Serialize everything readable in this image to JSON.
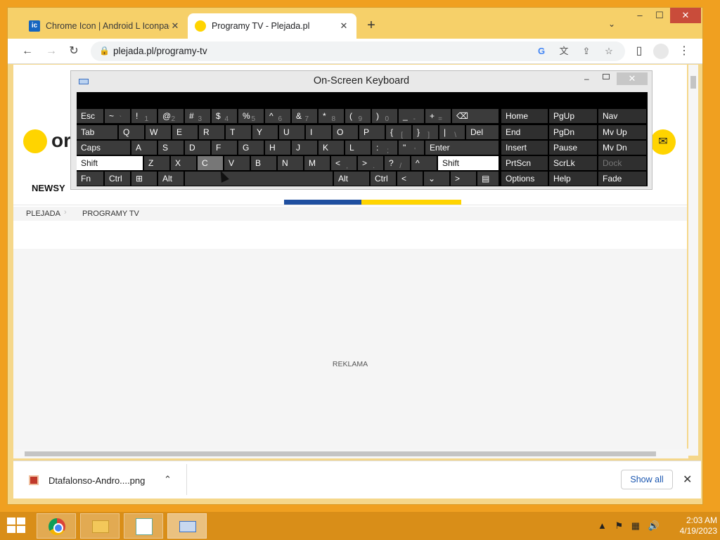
{
  "browser": {
    "tabs": [
      {
        "title": "Chrome Icon | Android L Iconpac",
        "favicon": "ic",
        "close": "✕"
      },
      {
        "title": "Programy TV - Plejada.pl",
        "close": "✕"
      }
    ],
    "new_tab": "+",
    "tab_search": "⌄",
    "window_controls": {
      "minimize": "–",
      "maximize": "☐",
      "close": "✕"
    },
    "toolbar": {
      "back": "←",
      "forward": "→",
      "reload": "↻",
      "menu": "⋮"
    },
    "url": "plejada.pl/programy-tv",
    "omnibox_icons": {
      "google": "G",
      "translate": "文",
      "share": "⇪",
      "star": "☆",
      "lock": "🔒"
    }
  },
  "page": {
    "logo_text": "or",
    "mail": "✉",
    "nav": {
      "news": "NEWSY"
    },
    "breadcrumb": [
      "PLEJADA",
      "PROGRAMY TV"
    ],
    "breadcrumb_separator": "›",
    "ad_label": "REKLAMA"
  },
  "download_bar": {
    "filename": "Dtafalonso-Andro....png",
    "chevron": "⌃",
    "show_all": "Show all",
    "close": "✕"
  },
  "osk": {
    "title": "On-Screen Keyboard",
    "controls": {
      "minimize": "–",
      "close": "✕"
    },
    "rows": [
      [
        {
          "label": "Esc"
        },
        {
          "label": "~",
          "sub": "`"
        },
        {
          "label": "!",
          "sub": "1"
        },
        {
          "label": "@",
          "sub": "2"
        },
        {
          "label": "#",
          "sub": "3"
        },
        {
          "label": "$",
          "sub": "4"
        },
        {
          "label": "%",
          "sub": "5"
        },
        {
          "label": "^",
          "sub": "6"
        },
        {
          "label": "&",
          "sub": "7"
        },
        {
          "label": "*",
          "sub": "8"
        },
        {
          "label": "(",
          "sub": "9"
        },
        {
          "label": ")",
          "sub": "0"
        },
        {
          "label": "_",
          "sub": "-"
        },
        {
          "label": "+",
          "sub": "="
        },
        {
          "label": "⌫"
        }
      ],
      [
        {
          "label": "Tab"
        },
        {
          "label": "Q"
        },
        {
          "label": "W"
        },
        {
          "label": "E"
        },
        {
          "label": "R"
        },
        {
          "label": "T"
        },
        {
          "label": "Y"
        },
        {
          "label": "U"
        },
        {
          "label": "I"
        },
        {
          "label": "O"
        },
        {
          "label": "P"
        },
        {
          "label": "{",
          "sub": "["
        },
        {
          "label": "}",
          "sub": "]"
        },
        {
          "label": "|",
          "sub": "\\"
        },
        {
          "label": "Del"
        }
      ],
      [
        {
          "label": "Caps"
        },
        {
          "label": "A"
        },
        {
          "label": "S"
        },
        {
          "label": "D"
        },
        {
          "label": "F"
        },
        {
          "label": "G"
        },
        {
          "label": "H"
        },
        {
          "label": "J"
        },
        {
          "label": "K"
        },
        {
          "label": "L"
        },
        {
          "label": ":",
          "sub": ";"
        },
        {
          "label": "\"",
          "sub": "'"
        },
        {
          "label": "Enter"
        }
      ],
      [
        {
          "label": "Shift"
        },
        {
          "label": "Z"
        },
        {
          "label": "X"
        },
        {
          "label": "C"
        },
        {
          "label": "V"
        },
        {
          "label": "B"
        },
        {
          "label": "N"
        },
        {
          "label": "M"
        },
        {
          "label": "<",
          "sub": ","
        },
        {
          "label": ">",
          "sub": "."
        },
        {
          "label": "?",
          "sub": "/"
        },
        {
          "label": "^"
        },
        {
          "label": "Shift"
        }
      ],
      [
        {
          "label": "Fn"
        },
        {
          "label": "Ctrl"
        },
        {
          "label": "⊞"
        },
        {
          "label": "Alt"
        },
        {
          "label": ""
        },
        {
          "label": "Alt"
        },
        {
          "label": "Ctrl"
        },
        {
          "label": "<"
        },
        {
          "label": "⌄"
        },
        {
          "label": ">"
        },
        {
          "label": "▤"
        }
      ]
    ],
    "nav_keys": [
      [
        "Home",
        "PgUp",
        "Nav"
      ],
      [
        "End",
        "PgDn",
        "Mv Up"
      ],
      [
        "Insert",
        "Pause",
        "Mv Dn"
      ],
      [
        "PrtScn",
        "ScrLk",
        "Dock"
      ],
      [
        "Options",
        "Help",
        "Fade"
      ]
    ]
  },
  "taskbar": {
    "apps": [
      "chrome-icon",
      "file-explorer-icon",
      "notepad-plus-plus-icon",
      "on-screen-keyboard-icon"
    ],
    "tray": {
      "up": "▲",
      "flag": "⚑",
      "network": "▦",
      "volume": "🔊"
    },
    "time": "2:03 AM",
    "date": "4/19/2023"
  },
  "colors": {
    "desktop": "#f0a020",
    "taskbar": "#d98e18",
    "accent_yellow": "#ffd400",
    "accent_blue": "#1f4fa0"
  }
}
